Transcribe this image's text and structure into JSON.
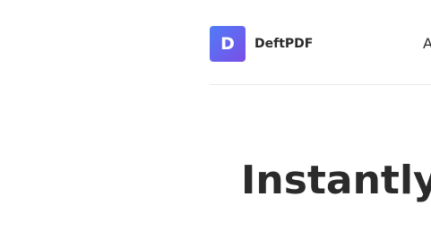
{
  "header": {
    "logo_letter": "D",
    "brand_name": "DeftPDF",
    "nav_partial": "A"
  },
  "hero": {
    "title": "Instantly"
  },
  "colors": {
    "logo_gradient_start": "#4f7cf7",
    "logo_gradient_end": "#7b4ee6",
    "text": "#2b2b2b",
    "divider": "#e8e8e8"
  }
}
